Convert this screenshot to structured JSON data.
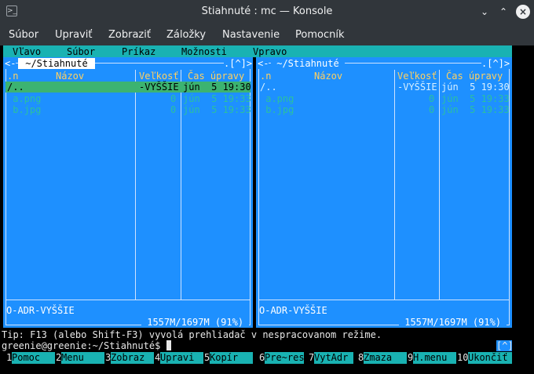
{
  "window": {
    "title": "Stiahnuté : mc — Konsole",
    "app_icon": ">_",
    "minimize_glyph": "⌄",
    "maximize_glyph": "⌃",
    "close_glyph": "×"
  },
  "konsole_menu": [
    "Súbor",
    "Upraviť",
    "Zobraziť",
    "Záložky",
    "Nastavenie",
    "Pomocník"
  ],
  "mc_menu": [
    "Vľavo",
    "Súbor",
    "Príkaz",
    "Možnosti",
    "Vpravo"
  ],
  "left_panel": {
    "corner_left": "<-",
    "path": " ~/Stiahnuté ",
    "corner_right": ".[^]>",
    "col_n": ".n",
    "col_name": "Názov",
    "col_size": "Veľkosť",
    "col_time": "Čas úpravy",
    "rows": [
      {
        "name": "/..",
        "size": "-VYŠŠIE",
        "time": "jún  5 19:30"
      },
      {
        "name": " a.png",
        "size": "0",
        "time": "jún  5 19:33"
      },
      {
        "name": " b.jpg",
        "size": "0",
        "time": "jún  5 19:33"
      }
    ],
    "mini_status": "O-ADR-VYŠŠIE",
    "disk_free": " 1557M/1697M (91%) "
  },
  "right_panel": {
    "corner_left": "<-",
    "path": " ~/Stiahnuté ",
    "corner_right": ".[^]>",
    "col_n": ".n",
    "col_name": "Názov",
    "col_size": "Veľkosť",
    "col_time": "Čas úpravy",
    "rows": [
      {
        "name": "/..",
        "size": "-VYŠŠIE",
        "time": "jún  5 19:30"
      },
      {
        "name": " a.png",
        "size": "0",
        "time": "jún  5 19:33"
      },
      {
        "name": " b.jpg",
        "size": "0",
        "time": "jún  5 19:33"
      }
    ],
    "mini_status": "O-ADR-VYŠŠIE",
    "disk_free": " 1557M/1697M (91%) "
  },
  "tip": "Tip: F13 (alebo Shift-F3) vyvolá prehliadač v nespracovanom režime.",
  "prompt": "greenie@greenie:~/Stiahnuté$ ",
  "history_button": "[^]",
  "fkeys": [
    {
      "num": "1",
      "label": "Pomoc"
    },
    {
      "num": "2",
      "label": "Menu"
    },
    {
      "num": "3",
      "label": "Zobraz"
    },
    {
      "num": "4",
      "label": "Upravi"
    },
    {
      "num": "5",
      "label": "Kopír"
    },
    {
      "num": "6",
      "label": "Pre~res"
    },
    {
      "num": "7",
      "label": "VytAdr"
    },
    {
      "num": "8",
      "label": "Zmaza"
    },
    {
      "num": "9",
      "label": "H.menu"
    },
    {
      "num": "10",
      "label": "Ukončiť"
    }
  ],
  "colors": {
    "panel_bg": "#1e90ff",
    "menu_bg": "#19b2b2",
    "cursor_bg": "#3cb371",
    "header_text": "#ffd060"
  }
}
